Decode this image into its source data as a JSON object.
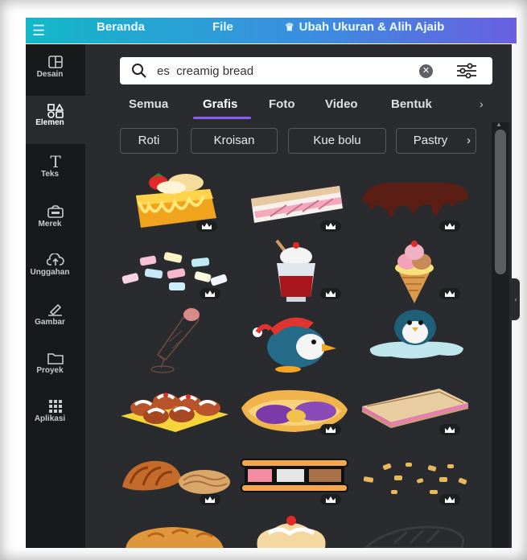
{
  "header": {
    "home": "Beranda",
    "file": "File",
    "resize": "Ubah Ukuran & Alih Ajaib"
  },
  "sidebar": {
    "items": [
      {
        "label": "Desain",
        "icon": "layout-icon"
      },
      {
        "label": "Elemen",
        "icon": "shapes-icon"
      },
      {
        "label": "Teks",
        "icon": "text-icon"
      },
      {
        "label": "Merek",
        "icon": "brand-icon"
      },
      {
        "label": "Unggahan",
        "icon": "upload-icon"
      },
      {
        "label": "Gambar",
        "icon": "draw-icon"
      },
      {
        "label": "Proyek",
        "icon": "folder-icon"
      },
      {
        "label": "Aplikasi",
        "icon": "apps-icon"
      }
    ]
  },
  "search": {
    "value": "es  creamig bread"
  },
  "tabs": [
    "Semua",
    "Grafis",
    "Foto",
    "Video",
    "Bentuk"
  ],
  "active_tab": "Grafis",
  "chips": [
    "Roti",
    "Kroisan",
    "Kue bolu",
    "Pastry"
  ],
  "colors": {
    "accent": "#8b5cf6",
    "panel": "#2a2b2e",
    "rail": "#18191b",
    "header_start": "#13b8c8",
    "header_end": "#6a5fe0"
  }
}
